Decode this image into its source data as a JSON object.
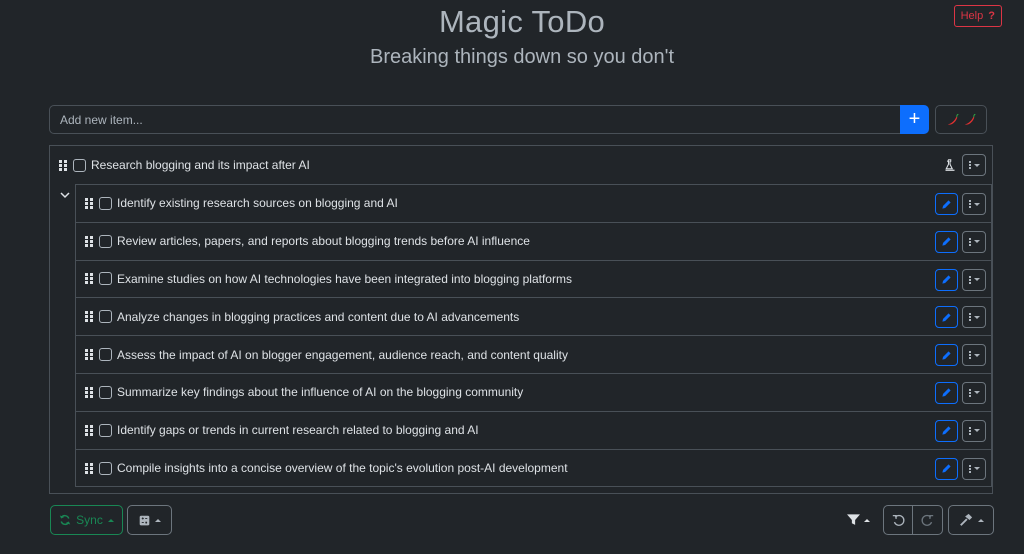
{
  "header": {
    "title": "Magic ToDo",
    "subtitle": "Breaking things down so you don't",
    "help_label": "Help",
    "help_icon": "?"
  },
  "add_item": {
    "placeholder": "Add new item...",
    "add_icon": "+"
  },
  "spiciness": {
    "icons": [
      "chili-pepper-icon",
      "chili-pepper-icon"
    ]
  },
  "task": {
    "label": "Research blogging and its impact after AI",
    "subtasks": [
      {
        "label": "Identify existing research sources on blogging and AI"
      },
      {
        "label": "Review articles, papers, and reports about blogging trends before AI influence"
      },
      {
        "label": "Examine studies on how AI technologies have been integrated into blogging platforms"
      },
      {
        "label": "Analyze changes in blogging practices and content due to AI advancements"
      },
      {
        "label": "Assess the impact of AI on blogger engagement, audience reach, and content quality"
      },
      {
        "label": "Summarize key findings about the influence of AI on the blogging community"
      },
      {
        "label": "Identify gaps or trends in current research related to blogging and AI"
      },
      {
        "label": "Compile insights into a concise overview of the topic's evolution post-AI development"
      }
    ]
  },
  "footer": {
    "sync_label": "Sync"
  },
  "colors": {
    "background": "#212529",
    "primary": "#0d6efd",
    "success": "#198754",
    "danger": "#dc3545",
    "border": "#495057"
  }
}
